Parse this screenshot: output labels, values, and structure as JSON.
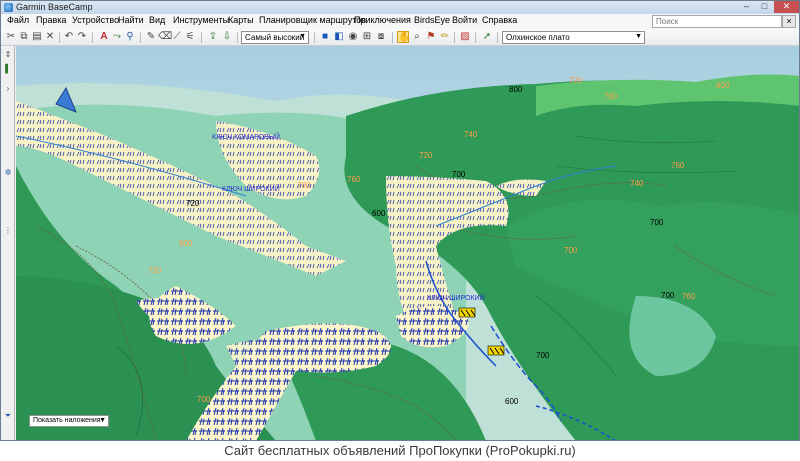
{
  "window": {
    "title": "Garmin BaseCamp",
    "minimize": "–",
    "maximize": "□",
    "close": "✕"
  },
  "menu": [
    "Файл",
    "Правка",
    "Устройство",
    "Найти",
    "Вид",
    "Инструменты",
    "Карты",
    "Планировщик маршрутов",
    "Приключения",
    "BirdsEye",
    "Войти",
    "Справка"
  ],
  "search": {
    "placeholder": "Поиск",
    "button": "×"
  },
  "toolbar": {
    "detail_dropdown": "Самый высокий",
    "map_dropdown": "Олхинское плато",
    "icons": [
      "cut-icon",
      "copy-icon",
      "paste-icon",
      "delete-icon",
      "undo-icon",
      "redo-icon",
      "text-icon",
      "measure-icon",
      "route-icon",
      "pencil-icon",
      "eraser-icon",
      "ruler-icon",
      "send-icon",
      "receive-icon",
      "map-2d-icon",
      "map-3d-icon",
      "grid-icon",
      "hand-icon",
      "zoom-icon",
      "pin-icon",
      "pencil2-icon",
      "stripe-icon",
      "flag-icon"
    ]
  },
  "map": {
    "labels": {
      "klyuch_komarovy": "КЛЮЧ КОМАРОВЫЙ",
      "klyuch_shirokiy_1": "КЛЮЧ ШИРОКИЙ",
      "klyuch_shirokiy_2": "КЛЮЧ ШИРОКИЙ"
    },
    "elevations": [
      "720",
      "800",
      "760",
      "800",
      "740",
      "720",
      "760",
      "700",
      "760",
      "740",
      "700",
      "600",
      "720",
      "700",
      "800",
      "700",
      "720",
      "700",
      "760",
      "700",
      "600",
      "700"
    ],
    "colors": {
      "forest": "#2f9a58",
      "forest_dark": "#1f7c42",
      "valley": "#6cc6a0",
      "marsh": "#fbf5c9",
      "sky": "#c9e2ec",
      "contour": "#6b5a3a"
    }
  },
  "overlay_select": "Показать наложения",
  "footer": "Сайт бесплатных объявлений ПроПокупки (ProPokupki.ru)"
}
